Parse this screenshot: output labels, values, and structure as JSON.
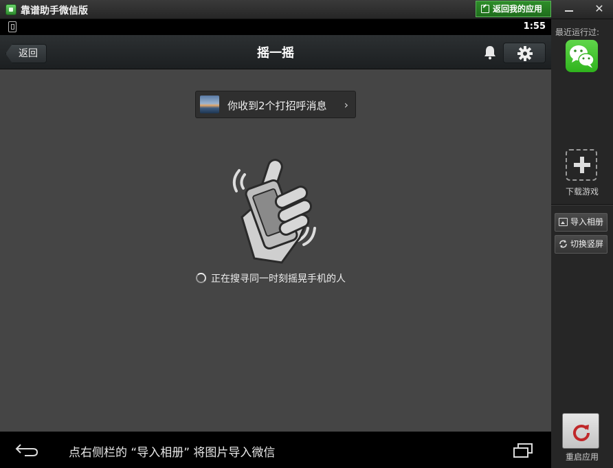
{
  "window": {
    "title": "靠谱助手微信版",
    "return_btn": "返回我的应用",
    "minimize_label": "—",
    "close_label": "✕"
  },
  "status_bar": {
    "time": "1:55"
  },
  "navbar": {
    "back_label": "返回",
    "title": "摇一摇"
  },
  "content": {
    "greeting_text": "你收到2个打招呼消息",
    "greeting_chevron": "›",
    "searching_text": "正在搜寻同一时刻摇晃手机的人",
    "drawer_handle": "▲"
  },
  "bottom_bar": {
    "hint": "点右侧栏的 “导入相册” 将图片导入微信"
  },
  "sidepanel": {
    "recent_label": "最近运行过:",
    "download_label": "下载游戏",
    "import_album": "导入相册",
    "toggle_orientation": "切换竖屏",
    "restart_label": "重启应用"
  },
  "colors": {
    "accent_green": "#2e8e2a",
    "wechat_green": "#46c434",
    "restart_red": "#c0282a"
  },
  "icons": [
    "app-logo-icon",
    "external-link-icon",
    "minimize-icon",
    "close-icon",
    "phone-status-icon",
    "bell-icon",
    "gear-icon",
    "chevron-right-icon",
    "shake-phone-icon",
    "spinner-icon",
    "triangle-up-icon",
    "back-arrow-icon",
    "recent-apps-icon",
    "wechat-icon",
    "plus-icon",
    "photo-icon",
    "rotate-icon",
    "refresh-icon"
  ]
}
